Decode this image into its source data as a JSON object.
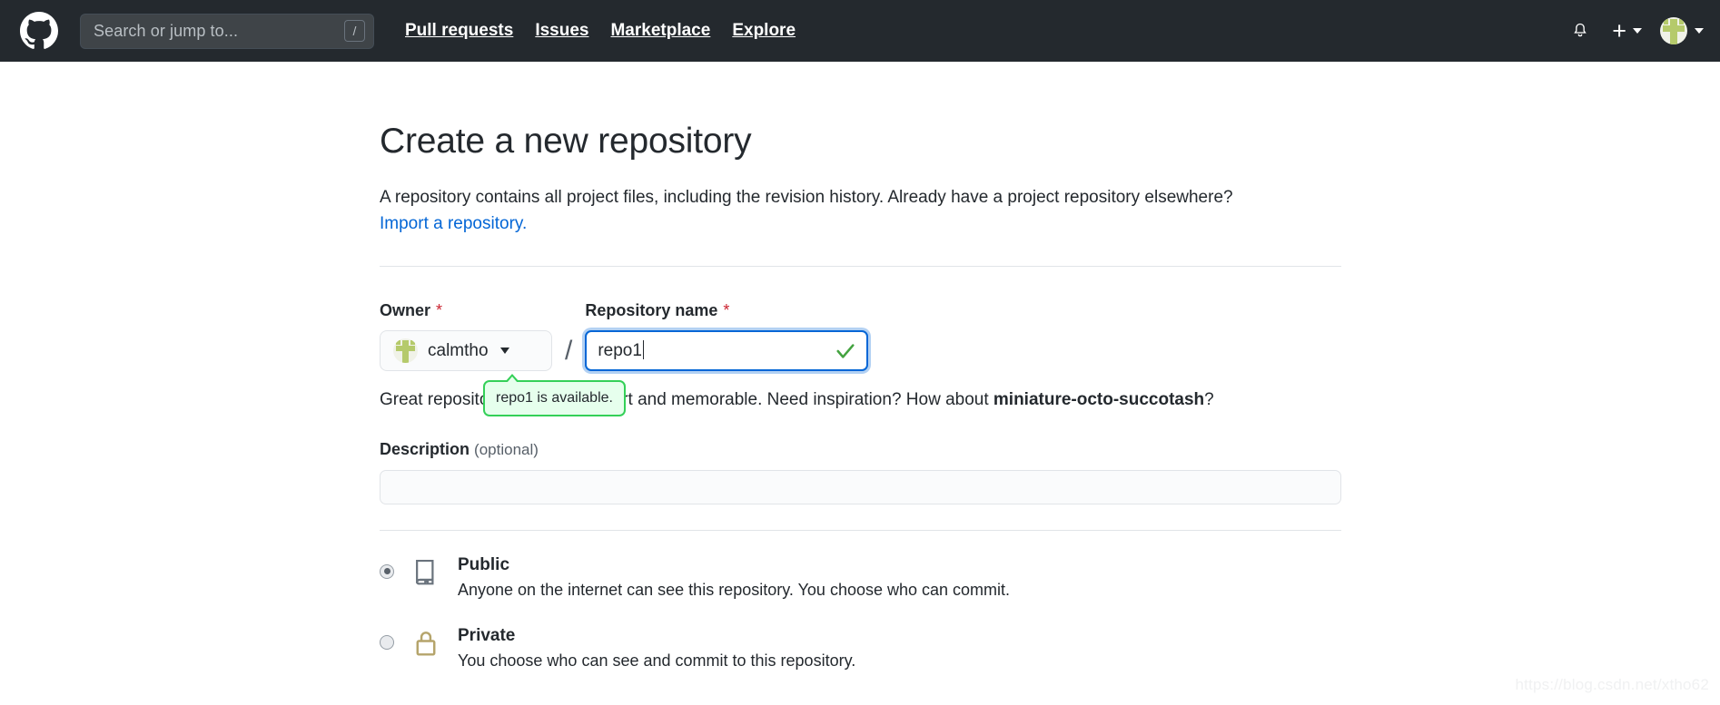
{
  "header": {
    "logo_icon": "github-mark-icon",
    "search": {
      "placeholder": "Search or jump to...",
      "shortcut_badge": "/"
    },
    "nav": [
      {
        "label": "Pull requests"
      },
      {
        "label": "Issues"
      },
      {
        "label": "Marketplace"
      },
      {
        "label": "Explore"
      }
    ],
    "notifications_icon": "bell-icon",
    "create_new": {
      "label": "+",
      "caret_icon": "chevron-down-icon"
    },
    "profile": {
      "avatar_icon": "user-avatar-icon",
      "caret_icon": "chevron-down-icon"
    },
    "background_color": "#24292e"
  },
  "main": {
    "title": "Create a new repository",
    "description": "A repository contains all project files, including the revision history. Already have a project repository elsewhere?",
    "import_link": "Import a repository.",
    "owner": {
      "label": "Owner",
      "required_mark": "*",
      "selected": "calmtho",
      "avatar_icon": "owner-avatar-icon",
      "caret_icon": "chevron-down-icon"
    },
    "separator": "/",
    "repo_name": {
      "label": "Repository name",
      "required_mark": "*",
      "value": "repo1",
      "valid_icon": "check-icon",
      "focus_color": "#0366d6"
    },
    "availability_tooltip": {
      "text": "repo1 is available.",
      "background_color": "#e6ffed",
      "border_color": "#34d058"
    },
    "hint": {
      "part1": "Great repository names are short and memorable. Need inspiration? How about ",
      "suggestion": "miniature-octo-succotash",
      "part2": "?"
    },
    "description_field": {
      "label": "Description",
      "optional": "(optional)",
      "value": ""
    },
    "visibility": [
      {
        "id": "public",
        "title": "Public",
        "description": "Anyone on the internet can see this repository. You choose who can commit.",
        "icon": "repo-book-icon",
        "selected": true
      },
      {
        "id": "private",
        "title": "Private",
        "description": "You choose who can see and commit to this repository.",
        "icon": "lock-icon",
        "selected": false
      }
    ]
  },
  "watermark": "https://blog.csdn.net/xtho62"
}
